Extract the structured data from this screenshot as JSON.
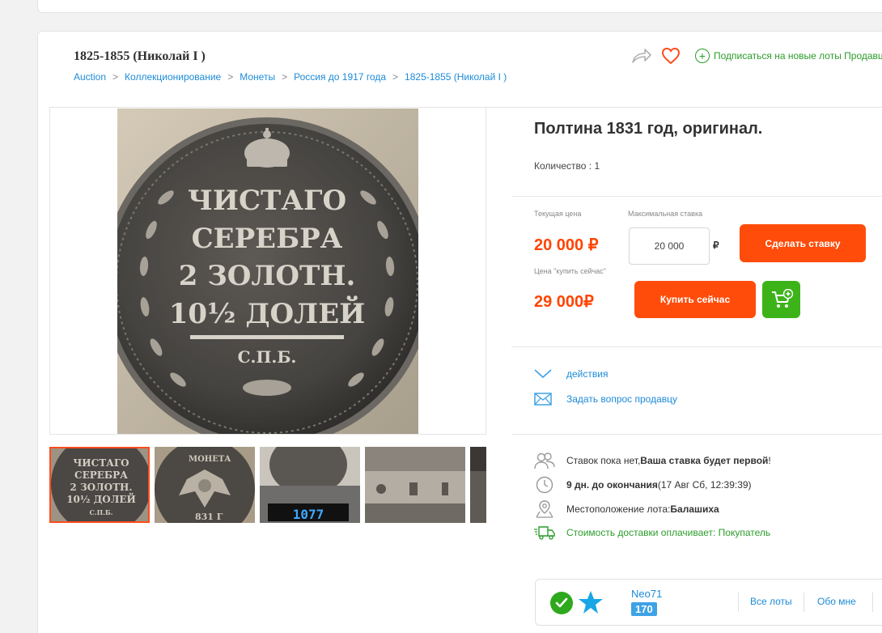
{
  "category_title": "1825-1855 (Николай I )",
  "breadcrumb": [
    "Auction",
    "Коллекционирование",
    "Монеты",
    "Россия до 1917 года",
    "1825-1855 (Николай I )"
  ],
  "subscribe_label": "Подписаться на новые лоты Продавца",
  "icons": [
    "share-icon",
    "heart-icon",
    "plus-circle-icon",
    "chevron-down-icon",
    "envelope-icon",
    "users-icon",
    "clock-icon",
    "location-pin-icon",
    "truck-icon",
    "check-icon",
    "star-icon",
    "cart-plus-icon"
  ],
  "coin": {
    "lines": [
      "ЧИСТАГО",
      "СЕРЕБРА",
      "2 ЗОЛОТН.",
      "10½ ДОЛЕЙ",
      "С.П.Б."
    ],
    "thumb_labels": [
      "МОНЕТА",
      "831 Г"
    ],
    "scale_readout": "1077"
  },
  "lot": {
    "title": "Полтина 1831 год, оригинал.",
    "quantity": "Количество : 1"
  },
  "bid": {
    "current_label": "Текущая цена",
    "current_price": "20 000 ₽",
    "max_bid_label": "Максимальная ставка",
    "bid_value": "20 000",
    "currency": "₽",
    "bid_button": "Сделать ставку",
    "buy_now_label": "Цена \"купить сейчас\"",
    "buy_now_price": "29 000₽",
    "buy_button": "Купить сейчас"
  },
  "actions": {
    "actions_label": "действия",
    "ask_label": "Задать вопрос продавцу"
  },
  "info": {
    "bids_prefix": "Ставок пока нет, ",
    "bids_bold": "Ваша ставка будет первой",
    "bids_suffix": "!",
    "time_bold": "9 дн. до окончания",
    "time_rest": " (17 Авг Сб, 12:39:39)",
    "location_prefix": "Местоположение лота: ",
    "location_bold": "Балашиха",
    "shipping": "Стоимость доставки оплачивает: Покупатель"
  },
  "seller": {
    "name": "Neo71",
    "rating": "170",
    "all_lots": "Все лоты",
    "about": "Обо мне"
  },
  "colors": {
    "accent_orange": "#ff4c0a",
    "accent_green": "#3db31a",
    "link_blue": "#1d8bd8"
  }
}
